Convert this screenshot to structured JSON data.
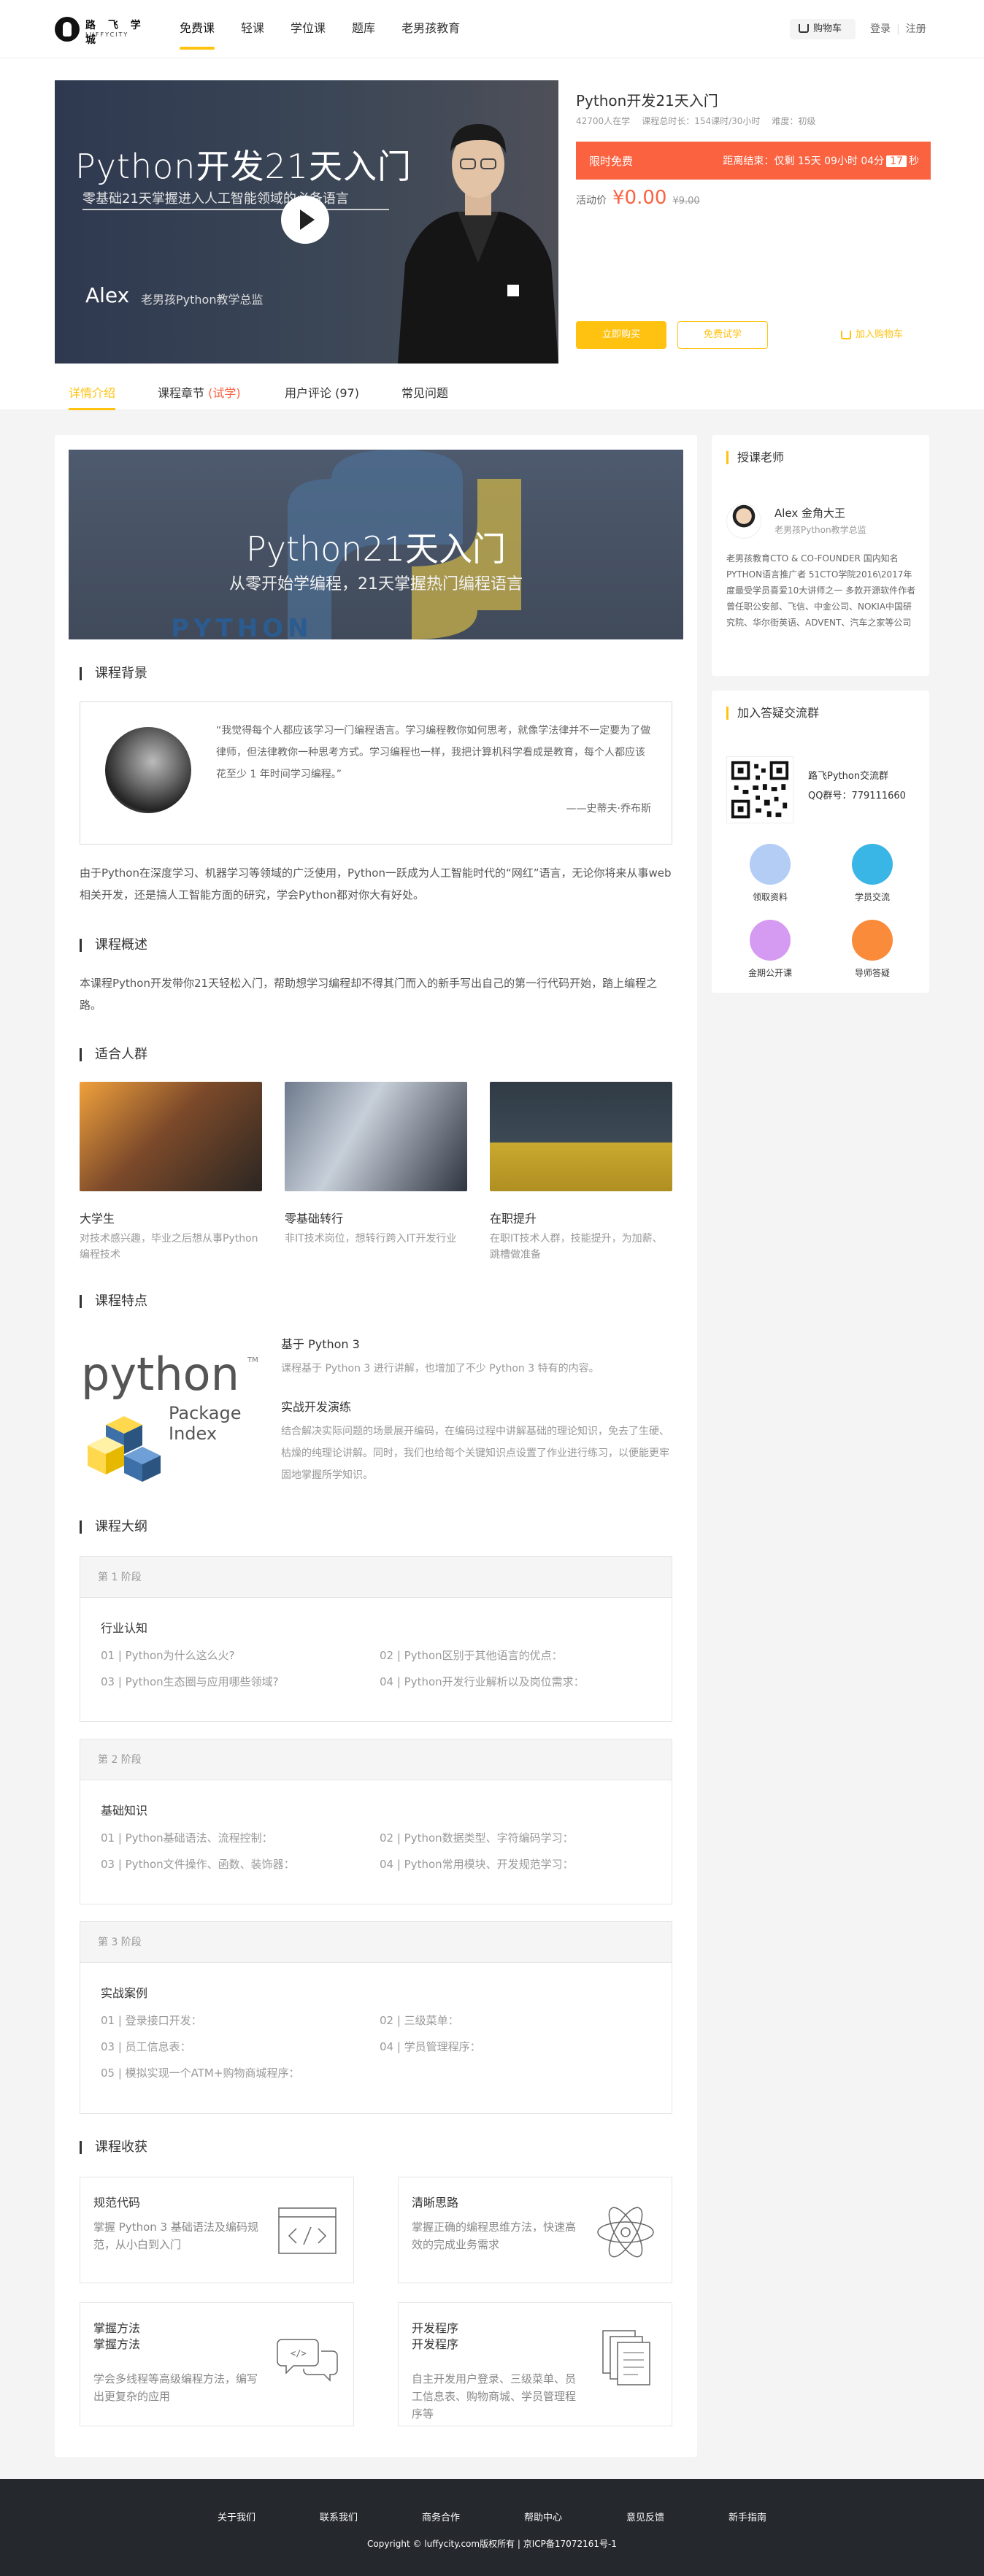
{
  "header": {
    "logo_text": "路 飞 学 城",
    "logo_sub": "LUFFYCITY",
    "nav": [
      "免费课",
      "轻课",
      "学位课",
      "题库",
      "老男孩教育"
    ],
    "cart": "购物车",
    "login": "登录",
    "sep": "|",
    "register": "注册"
  },
  "video": {
    "title": "Python开发21天入门",
    "subtitle": "零基础21天掌握进入人工智能领域的必备语言",
    "author": "Alex",
    "author_sub": "老男孩Python教学总监"
  },
  "course": {
    "title": "Python开发21天入门",
    "students": "42700人在学",
    "duration": "课程总时长：154课时/30小时",
    "level": "难度：初级",
    "promo_label": "限时免费",
    "countdown_prefix": "距离结束：仅剩 15天 09小时 04分",
    "countdown_sec": "17",
    "countdown_suffix": "秒",
    "price_label": "活动价",
    "price_now": "¥0.00",
    "price_old": "¥9.00",
    "buy_btn": "立即购买",
    "try_btn": "免费试学",
    "cart_btn": "加入购物车"
  },
  "tabs": {
    "t1": "详情介绍",
    "t2": "课程章节",
    "t2_hl": "(试学)",
    "t3": "用户评论 (97)",
    "t4": "常见问题"
  },
  "banner": {
    "title": "Python21天入门",
    "subtitle": "从零开始学编程，21天掌握热门编程语言",
    "word": "PYTHON"
  },
  "background": {
    "heading": "课程背景",
    "quote": "“我觉得每个人都应该学习一门编程语言。学习编程教你如何思考，就像学法律并不一定要为了做律师，但法律教你一种思考方式。学习编程也一样，我把计算机科学看成是教育，每个人都应该花至少 1 年时间学习编程。”",
    "quote_by": "——史蒂夫·乔布斯",
    "para": "由于Python在深度学习、机器学习等领域的广泛使用，Python一跃成为人工智能时代的“网红”语言，无论你将来从事web相关开发，还是搞人工智能方面的研究，学会Python都对你大有好处。"
  },
  "overview": {
    "heading": "课程概述",
    "para": "本课程Python开发带你21天轻松入门，帮助想学习编程却不得其门而入的新手写出自己的第一行代码开始，踏上编程之路。"
  },
  "audience": {
    "heading": "适合人群",
    "items": [
      {
        "name": "大学生",
        "desc": "对技术感兴趣，毕业之后想从事Python编程技术"
      },
      {
        "name": "零基础转行",
        "desc": "非IT技术岗位，想转行跨入IT开发行业"
      },
      {
        "name": "在职提升",
        "desc": "在职IT技术人群，技能提升，为加薪、跳槽做准备"
      }
    ]
  },
  "features": {
    "heading": "课程特点",
    "logo_word": "python",
    "logo_tm": "TM",
    "logo_pkg": "Package",
    "logo_idx": "Index",
    "items": [
      {
        "title": "基于 Python 3",
        "desc": "课程基于 Python 3 进行讲解，也增加了不少 Python 3 特有的内容。"
      },
      {
        "title": "实战开发演练",
        "desc": "结合解决实际问题的场景展开编码，在编码过程中讲解基础的理论知识，免去了生硬、枯燥的纯理论讲解。同时，我们也给每个关键知识点设置了作业进行练习，以便能更牢固地掌握所学知识。"
      }
    ]
  },
  "outline": {
    "heading": "课程大纲",
    "stages": [
      {
        "label": "第 1 阶段",
        "name": "行业认知",
        "lessons": [
          "01 | Python为什么这么火?",
          "02 | Python区别于其他语言的优点：",
          "03 | Python生态圈与应用哪些领域?",
          "04 | Python开发行业解析以及岗位需求："
        ]
      },
      {
        "label": "第 2 阶段",
        "name": "基础知识",
        "lessons": [
          "01 | Python基础语法、流程控制：",
          "02 | Python数据类型、字符编码学习：",
          "03 | Python文件操作、函数、装饰器：",
          "04 | Python常用模块、开发规范学习："
        ]
      },
      {
        "label": "第 3 阶段",
        "name": "实战案例",
        "lessons": [
          "01 | 登录接口开发：",
          "02 | 三级菜单：",
          "03 | 员工信息表：",
          "04 | 学员管理程序：",
          "05 | 模拟实现一个ATM+购物商城程序："
        ]
      }
    ]
  },
  "gains": {
    "heading": "课程收获",
    "items": [
      {
        "title": "规范代码",
        "desc": "掌握 Python 3 基础语法及编码规范，从小白到入门"
      },
      {
        "title": "清晰思路",
        "desc": "掌握正确的编程思维方法，快速高效的完成业务需求"
      },
      {
        "title": "掌握方法\n掌握方法",
        "desc": "学会多线程等高级编程方法，编写出更复杂的应用"
      },
      {
        "title": "开发程序\n开发程序",
        "desc": "自主开发用户登录、三级菜单、员工信息表、购物商城、学员管理程序等"
      }
    ]
  },
  "teacher": {
    "heading": "授课老师",
    "name": "Alex 金角大王",
    "title": "老男孩Python教学总监",
    "bio": "老男孩教育CTO & CO-FOUNDER 国内知名PYTHON语言推广者 51CTO学院2016\\2017年度最受学员喜爱10大讲师之一 多款开源软件作者 曾任职公安部、飞信、中金公司、NOKIA中国研究院、华尔街英语、ADVENT、汽车之家等公司"
  },
  "group": {
    "heading": "加入答疑交流群",
    "name": "路飞Python交流群",
    "qq": "QQ群号：779111660",
    "items": [
      "领取资料",
      "学员交流",
      "金期公开课",
      "导师答疑"
    ]
  },
  "footer": {
    "links": [
      "关于我们",
      "联系我们",
      "商务合作",
      "帮助中心",
      "意见反馈",
      "新手指南"
    ],
    "copyright": "Copyright © luffycity.com版权所有 | 京ICP备17072161号-1"
  },
  "colors": {
    "accent": "#ffc210",
    "promo": "#fa6240",
    "footer": "#25282d"
  }
}
